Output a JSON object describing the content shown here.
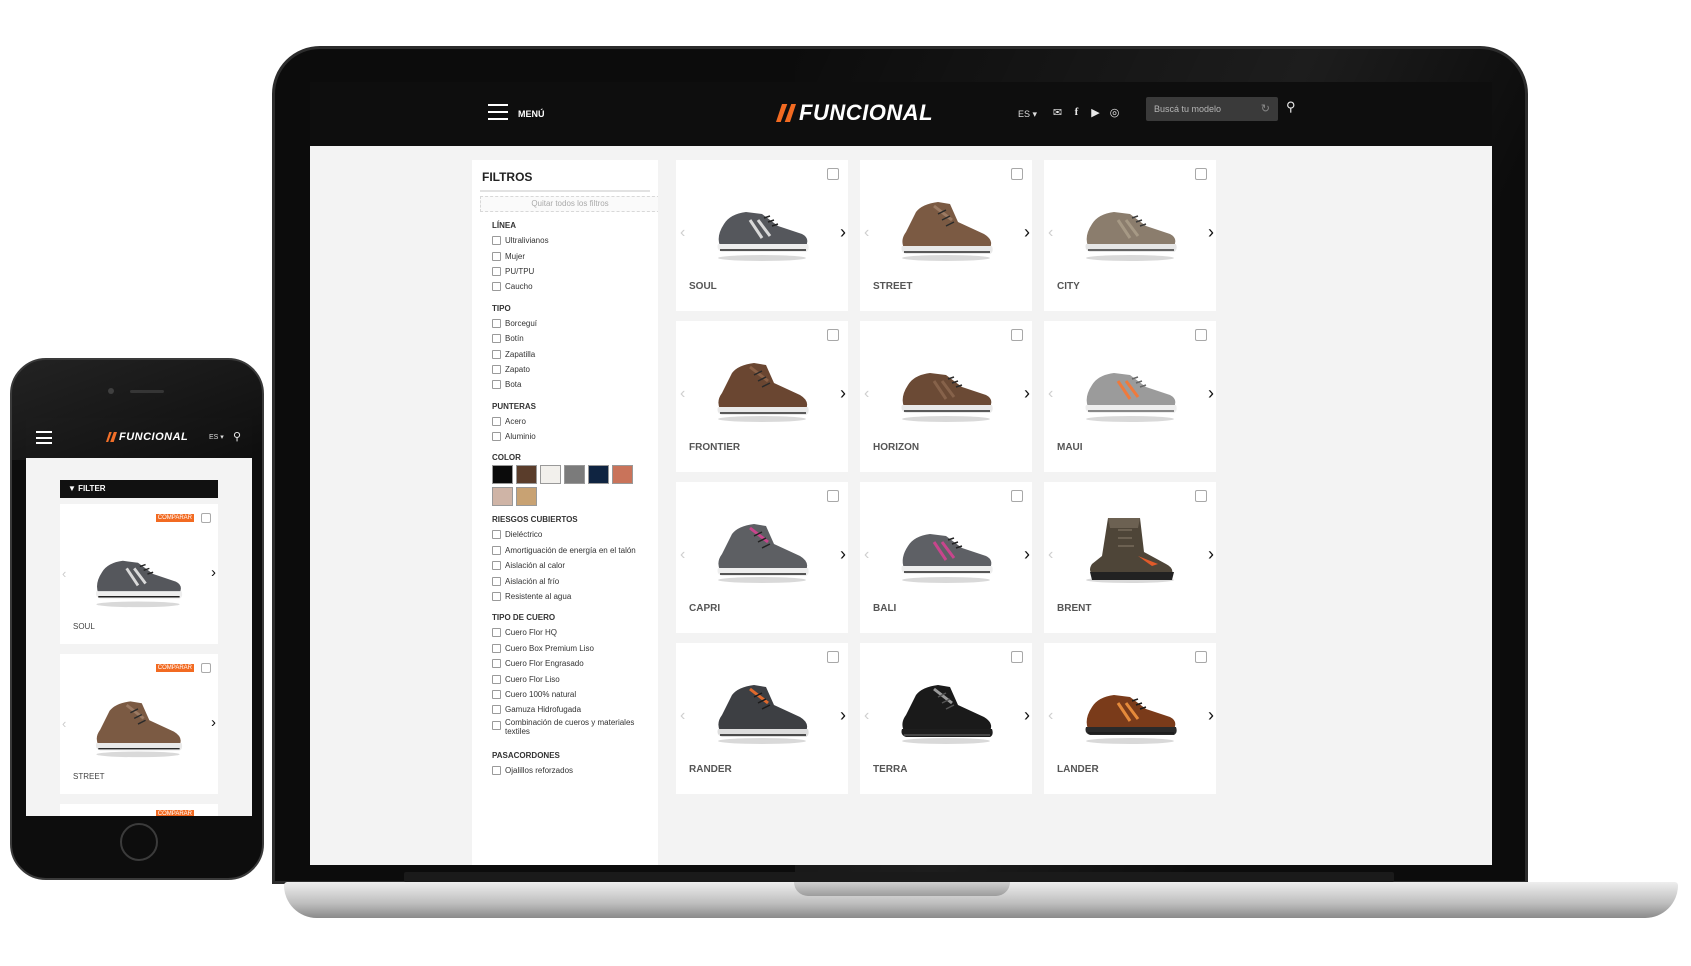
{
  "header": {
    "menu_label": "MENÚ",
    "brand": "FUNCIONAL",
    "lang": "ES ▾",
    "search_placeholder": "Buscá tu modelo"
  },
  "filters": {
    "title": "FILTROS",
    "clear_all": "Quitar todos los filtros",
    "groups": {
      "linea": {
        "title": "LÍNEA",
        "items": [
          "Ultralivianos",
          "Mujer",
          "PU/TPU",
          "Caucho"
        ]
      },
      "tipo": {
        "title": "TIPO",
        "items": [
          "Borceguí",
          "Botín",
          "Zapatilla",
          "Zapato",
          "Bota"
        ]
      },
      "punteras": {
        "title": "PUNTERAS",
        "items": [
          "Acero",
          "Aluminio"
        ]
      },
      "color": {
        "title": "COLOR",
        "swatches": [
          "#0b0b0b",
          "#5a3d2b",
          "#f2f0ec",
          "#7b7b7b",
          "#0f2441",
          "#c9735a",
          "#cfb4a6",
          "#c8a273"
        ]
      },
      "riesgos": {
        "title": "RIESGOS CUBIERTOS",
        "items": [
          "Dieléctrico",
          "Amortiguación de energía en el talón",
          "Aislación al calor",
          "Aislación al frío",
          "Resistente al agua"
        ]
      },
      "cuero": {
        "title": "TIPO DE CUERO",
        "items": [
          "Cuero Flor HQ",
          "Cuero Box Premium Liso",
          "Cuero Flor Engrasado",
          "Cuero Flor Liso",
          "Cuero 100% natural",
          "Gamuza Hidrofugada",
          "Combinación de cueros y materiales textiles"
        ]
      },
      "pasacordones": {
        "title": "PASACORDONES",
        "items": [
          "Ojalillos reforzados"
        ]
      }
    }
  },
  "products": [
    {
      "name": "SOUL",
      "shape": "low",
      "upper": "#55575c",
      "accent": "#d9d9d9",
      "sole": "#eeeeee",
      "trim": "#222222"
    },
    {
      "name": "STREET",
      "shape": "mid",
      "upper": "#7b5a43",
      "accent": "#9b7a63",
      "sole": "#e9e9e9",
      "trim": "#2a2a2a"
    },
    {
      "name": "CITY",
      "shape": "low",
      "upper": "#8b7d6d",
      "accent": "#a69985",
      "sole": "#e6e6e6",
      "trim": "#3a3a3a"
    },
    {
      "name": "FRONTIER",
      "shape": "mid",
      "upper": "#6a4631",
      "accent": "#8a6046",
      "sole": "#e9e9e9",
      "trim": "#2a2a2a"
    },
    {
      "name": "HORIZON",
      "shape": "low",
      "upper": "#6b4a35",
      "accent": "#86624a",
      "sole": "#e9e9e9",
      "trim": "#2a2a2a"
    },
    {
      "name": "MAUI",
      "shape": "low",
      "upper": "#9b9b9b",
      "accent": "#ef7a3c",
      "sole": "#eeeeee",
      "trim": "#666666"
    },
    {
      "name": "CAPRI",
      "shape": "mid",
      "upper": "#5d5f63",
      "accent": "#c8458c",
      "sole": "#eeeeee",
      "trim": "#222222"
    },
    {
      "name": "BALI",
      "shape": "low",
      "upper": "#5e6065",
      "accent": "#c8458c",
      "sole": "#eeeeee",
      "trim": "#222222"
    },
    {
      "name": "BRENT",
      "shape": "boot",
      "upper": "#4e4538",
      "accent": "#e15a2a",
      "sole": "#222222",
      "trim": "#6c6152"
    },
    {
      "name": "RANDER",
      "shape": "mid",
      "upper": "#3d3f43",
      "accent": "#e0692c",
      "sole": "#dddddd",
      "trim": "#1b1b1b"
    },
    {
      "name": "TERRA",
      "shape": "mid",
      "upper": "#1a1a1a",
      "accent": "#9a9a9a",
      "sole": "#1e1e1e",
      "trim": "#555555"
    },
    {
      "name": "LANDER",
      "shape": "low",
      "upper": "#7a3b1a",
      "accent": "#e58a3a",
      "sole": "#2a2a2a",
      "trim": "#1b1b1b"
    }
  ],
  "mobile": {
    "brand": "FUNCIONAL",
    "lang": "ES ▾",
    "filter_label": "FILTER",
    "compare_label": "COMPARAR",
    "products": [
      {
        "name": "SOUL",
        "shape": "low",
        "upper": "#55575c",
        "accent": "#d9d9d9",
        "sole": "#eeeeee",
        "trim": "#222222"
      },
      {
        "name": "STREET",
        "shape": "mid",
        "upper": "#7b5a43",
        "accent": "#9b7a63",
        "sole": "#e9e9e9",
        "trim": "#2a2a2a"
      }
    ]
  },
  "icons": {
    "search": "search-icon",
    "mail": "mail-icon",
    "facebook": "facebook-icon",
    "youtube": "youtube-icon",
    "instagram": "instagram-icon",
    "refresh": "refresh-icon",
    "filter": "filter-icon",
    "prev": "chevron-left-icon",
    "next": "chevron-right-icon"
  }
}
